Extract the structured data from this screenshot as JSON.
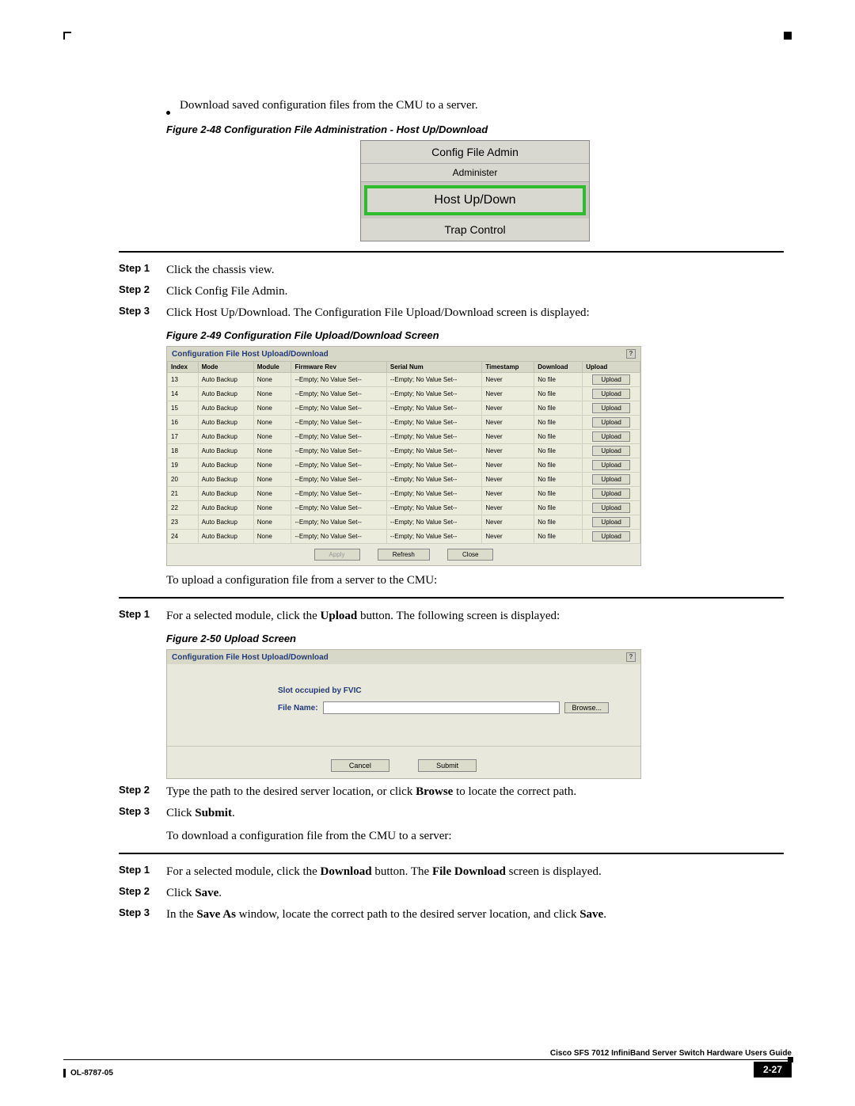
{
  "bullet_text": "Download saved configuration files from the CMU to a server.",
  "fig48_caption": "Figure 2-48   Configuration File Administration - Host Up/Download",
  "menu": {
    "item1": "Config File Admin",
    "item2": "Administer",
    "highlight": "Host Up/Down",
    "item3": "Trap Control"
  },
  "steps_a": {
    "s1_label": "Step 1",
    "s1_text": "Click the chassis view.",
    "s2_label": "Step 2",
    "s2_text": "Click Config File Admin.",
    "s3_label": "Step 3",
    "s3_text": "Click Host Up/Download. The Configuration File Upload/Download screen is displayed:"
  },
  "fig49_caption": "Figure 2-49   Configuration File Upload/Download Screen",
  "table": {
    "title": "Configuration File Host Upload/Download",
    "headers": [
      "Index",
      "Mode",
      "Module",
      "Firmware Rev",
      "Serial Num",
      "Timestamp",
      "Download",
      "Upload"
    ],
    "rows": [
      [
        "13",
        "Auto Backup",
        "None",
        "--Empty; No Value Set--",
        "--Empty; No Value Set--",
        "Never",
        "No file",
        "Upload"
      ],
      [
        "14",
        "Auto Backup",
        "None",
        "--Empty; No Value Set--",
        "--Empty; No Value Set--",
        "Never",
        "No file",
        "Upload"
      ],
      [
        "15",
        "Auto Backup",
        "None",
        "--Empty; No Value Set--",
        "--Empty; No Value Set--",
        "Never",
        "No file",
        "Upload"
      ],
      [
        "16",
        "Auto Backup",
        "None",
        "--Empty; No Value Set--",
        "--Empty; No Value Set--",
        "Never",
        "No file",
        "Upload"
      ],
      [
        "17",
        "Auto Backup",
        "None",
        "--Empty; No Value Set--",
        "--Empty; No Value Set--",
        "Never",
        "No file",
        "Upload"
      ],
      [
        "18",
        "Auto Backup",
        "None",
        "--Empty; No Value Set--",
        "--Empty; No Value Set--",
        "Never",
        "No file",
        "Upload"
      ],
      [
        "19",
        "Auto Backup",
        "None",
        "--Empty; No Value Set--",
        "--Empty; No Value Set--",
        "Never",
        "No file",
        "Upload"
      ],
      [
        "20",
        "Auto Backup",
        "None",
        "--Empty; No Value Set--",
        "--Empty; No Value Set--",
        "Never",
        "No file",
        "Upload"
      ],
      [
        "21",
        "Auto Backup",
        "None",
        "--Empty; No Value Set--",
        "--Empty; No Value Set--",
        "Never",
        "No file",
        "Upload"
      ],
      [
        "22",
        "Auto Backup",
        "None",
        "--Empty; No Value Set--",
        "--Empty; No Value Set--",
        "Never",
        "No file",
        "Upload"
      ],
      [
        "23",
        "Auto Backup",
        "None",
        "--Empty; No Value Set--",
        "--Empty; No Value Set--",
        "Never",
        "No file",
        "Upload"
      ],
      [
        "24",
        "Auto Backup",
        "None",
        "--Empty; No Value Set--",
        "--Empty; No Value Set--",
        "Never",
        "No file",
        "Upload"
      ]
    ],
    "btn_apply": "Apply",
    "btn_refresh": "Refresh",
    "btn_close": "Close"
  },
  "upload_intro": "To upload a configuration file from a server to the CMU:",
  "steps_b": {
    "s1_label": "Step 1",
    "s1_pre": "For a selected module, click the ",
    "s1_bold": "Upload",
    "s1_post": " button. The following screen is displayed:"
  },
  "fig50_caption": "Figure 2-50   Upload Screen",
  "upload_fig": {
    "title": "Configuration File Host Upload/Download",
    "slot": "Slot occupied by FVIC",
    "file_label": "File Name:",
    "browse": "Browse...",
    "cancel": "Cancel",
    "submit": "Submit"
  },
  "steps_c": {
    "s2_label": "Step 2",
    "s2_pre": "Type the path to the desired server location, or click ",
    "s2_bold": "Browse",
    "s2_post": " to locate the correct path.",
    "s3_label": "Step 3",
    "s3_pre": "Click ",
    "s3_bold": "Submit",
    "s3_post": "."
  },
  "download_intro": "To download a configuration file from the CMU to a server:",
  "steps_d": {
    "s1_label": "Step 1",
    "s1_pre": "For a selected module, click the ",
    "s1_b1": "Download",
    "s1_mid": " button. The ",
    "s1_b2": "File Download",
    "s1_post": " screen is displayed.",
    "s2_label": "Step 2",
    "s2_pre": "Click ",
    "s2_bold": "Save",
    "s2_post": ".",
    "s3_label": "Step 3",
    "s3_pre": "In the ",
    "s3_b1": "Save As",
    "s3_mid": " window, locate the correct path to the desired server location, and click ",
    "s3_b2": "Save",
    "s3_post": "."
  },
  "footer": {
    "title": "Cisco SFS 7012 InfiniBand Server Switch Hardware Users Guide",
    "doc": "OL-8787-05",
    "page": "2-27"
  },
  "help_icon": "?"
}
